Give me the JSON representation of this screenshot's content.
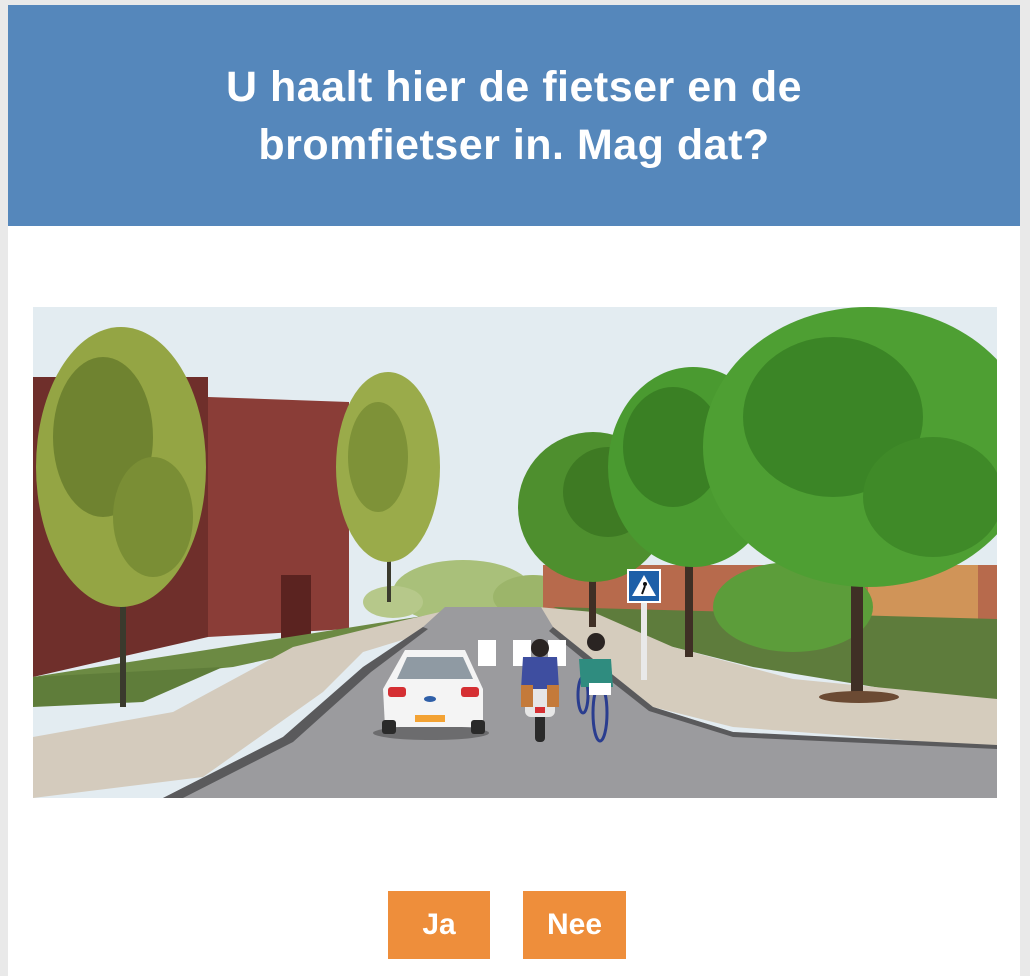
{
  "question": {
    "text": "U haalt hier de fietser en de bromfietser in. Mag dat?"
  },
  "scene": {
    "sign_icon": "pedestrian-crossing-sign-icon",
    "colors": {
      "header": "#5587bb",
      "button": "#ee8e3b",
      "building": "#7a3530",
      "road": "#9a9a9d",
      "grass": "#5e7c3c"
    }
  },
  "answers": {
    "yes_label": "Ja",
    "no_label": "Nee"
  }
}
